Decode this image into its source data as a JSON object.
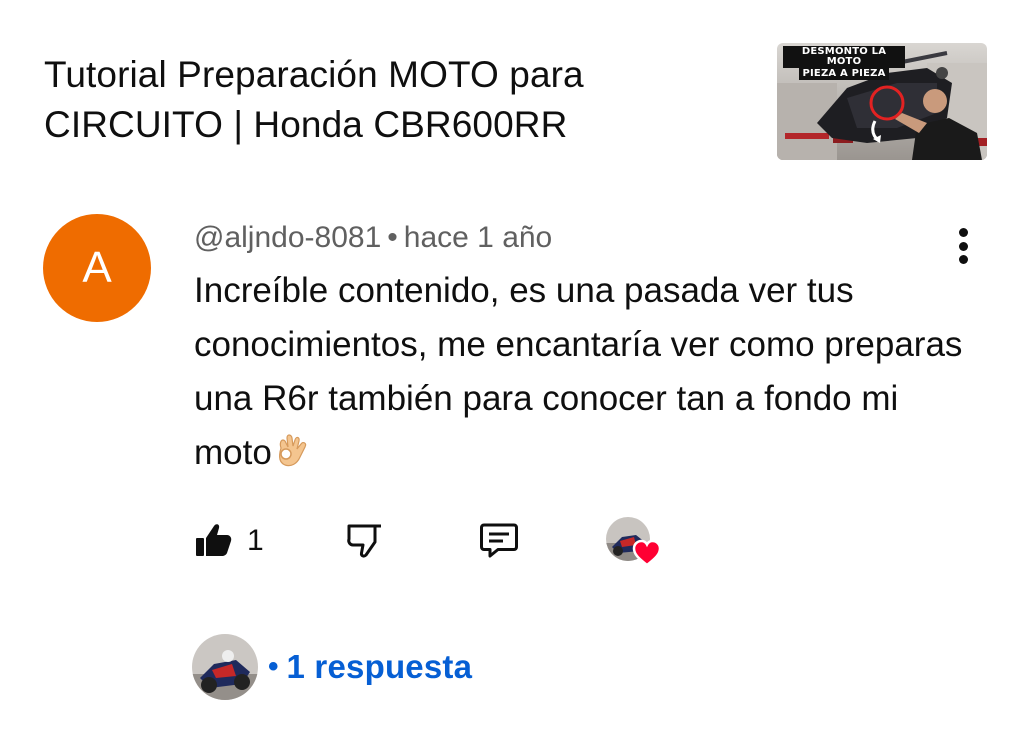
{
  "video": {
    "title": "Tutorial Preparación MOTO para CIRCUITO | Honda CBR600RR",
    "thumbnail_text_line1": "DESMONTO LA MOTO",
    "thumbnail_text_line2": "PIEZA A PIEZA"
  },
  "comment": {
    "avatar_letter": "A",
    "avatar_color": "#ef6c00",
    "author": "@aljndo-8081",
    "separator": "•",
    "time": "hace 1 año",
    "text": "Increíble contenido, es una pasada ver tus conocimientos, me encantaría ver como preparas una R6r también para conocer tan a fondo mi moto",
    "emoji": "ok-hand-emoji",
    "like_count": "1",
    "creator_hearted": true
  },
  "actions": {
    "like_icon": "thumbs-up-icon",
    "dislike_icon": "thumbs-down-icon",
    "reply_icon": "reply-icon",
    "more_icon": "more-vertical-icon"
  },
  "replies": {
    "bullet": "•",
    "label": "1 respuesta",
    "color": "#065fd4"
  }
}
